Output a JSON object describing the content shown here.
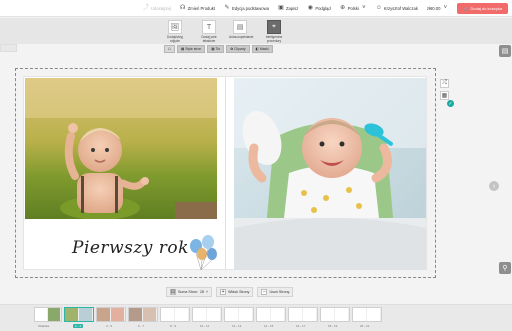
{
  "topbar": {
    "items": [
      {
        "label": "Udostępnij",
        "icon": "share-icon",
        "muted": true
      },
      {
        "label": "Zmień Produkt",
        "icon": "headphones-icon"
      },
      {
        "label": "Edycja podstawowa",
        "icon": "edit-icon"
      },
      {
        "label": "Zapisz",
        "icon": "save-icon"
      },
      {
        "label": "Podgląd",
        "icon": "eye-icon"
      },
      {
        "label": "Polski",
        "icon": "globe-icon"
      },
      {
        "label": "Krzysztof Walczak",
        "icon": "user-icon"
      },
      {
        "label": "zł60.00",
        "icon": "chevron-down-icon"
      }
    ],
    "cart_label": "Dodaj do koszyka"
  },
  "tools": [
    {
      "label": "Dodaj/ukryj zdjęcie",
      "icon": "photo-icon"
    },
    {
      "label": "Dodaj pole tekstowe",
      "icon": "text-icon"
    },
    {
      "label": "Autouzupełnianie",
      "icon": "autofill-icon"
    },
    {
      "label": "Inteligentne procedury",
      "icon": "smart-icon"
    }
  ],
  "subtabs": [
    "Style stron",
    "Tło",
    "Cliparty",
    "Maski"
  ],
  "spread": {
    "title": "Pierwszy rok"
  },
  "bottom": {
    "page_count_label": "Suma Stron:",
    "page_count_value": "28",
    "add_label": "Widok Strony",
    "remove_label": "Usuń Stronę"
  },
  "strip": {
    "labels": [
      "Okładka",
      "2 - 3",
      "4 - 5",
      "6 - 7",
      "8 - 9",
      "10 - 11",
      "12 - 13",
      "14 - 15",
      "16 - 17",
      "18 - 19",
      "20 - 21",
      "22 - 23"
    ]
  },
  "colors": {
    "accent": "#2db6a7",
    "cart": "#f26b6b"
  }
}
